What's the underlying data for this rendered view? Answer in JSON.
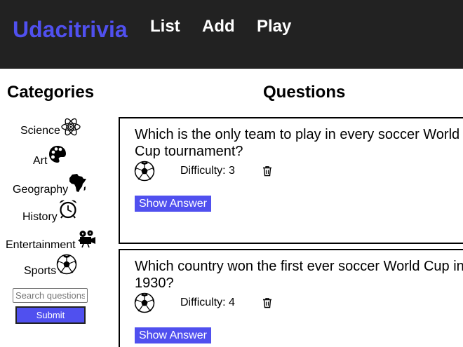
{
  "header": {
    "brand": "Udacitrivia",
    "nav": [
      "List",
      "Add",
      "Play"
    ]
  },
  "sidebar": {
    "title": "Categories",
    "categories": [
      {
        "label": "Science",
        "icon": "science-icon"
      },
      {
        "label": "Art",
        "icon": "art-icon"
      },
      {
        "label": "Geography",
        "icon": "geography-icon"
      },
      {
        "label": "History",
        "icon": "history-icon"
      },
      {
        "label": "Entertainment",
        "icon": "entertainment-icon"
      },
      {
        "label": "Sports",
        "icon": "sports-icon"
      }
    ],
    "search_placeholder": "Search questions...",
    "submit_label": "Submit"
  },
  "main": {
    "title": "Questions",
    "questions": [
      {
        "text": "Which is the only team to play in every soccer World Cup tournament?",
        "difficulty": "Difficulty: 3",
        "category_icon": "sports-icon",
        "show_answer": "Show Answer"
      },
      {
        "text": "Which country won the first ever soccer World Cup in 1930?",
        "difficulty": "Difficulty: 4",
        "category_icon": "sports-icon",
        "show_answer": "Show Answer"
      }
    ]
  },
  "colors": {
    "accent": "#5050ef",
    "header_bg": "#222222"
  }
}
